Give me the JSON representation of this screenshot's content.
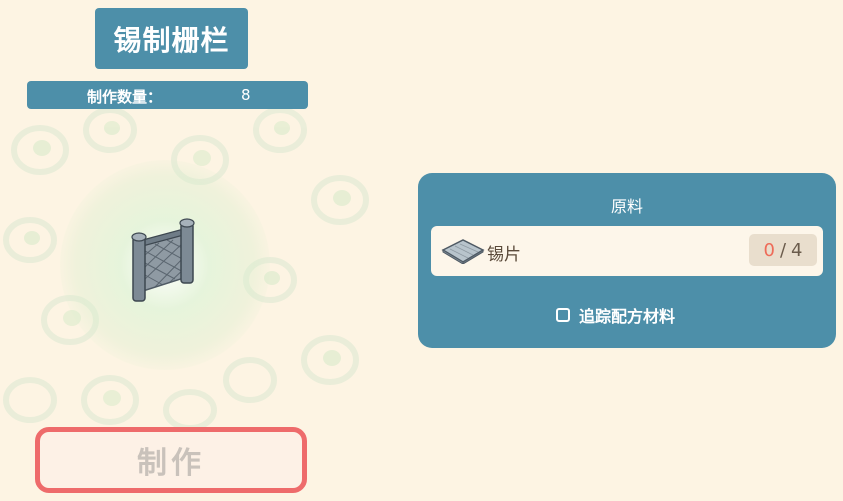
{
  "item": {
    "title": "锡制栅栏",
    "icon": "tin-fence-icon"
  },
  "quantity": {
    "label": "制作数量：",
    "value": "8"
  },
  "craft_button": {
    "label": "制作"
  },
  "materials_panel": {
    "title": "原料",
    "items": [
      {
        "name": "锡片",
        "icon": "tin-sheet-icon",
        "have": "0",
        "separator": "/",
        "need": "4"
      }
    ],
    "track_label": "追踪配方材料",
    "track_checked": false
  },
  "colors": {
    "background": "#fdf4e3",
    "panel": "#4d8fa9",
    "button_border": "#ee6b6b",
    "button_text_disabled": "#c9c2bb",
    "count_shortfall": "#ee6b58"
  }
}
